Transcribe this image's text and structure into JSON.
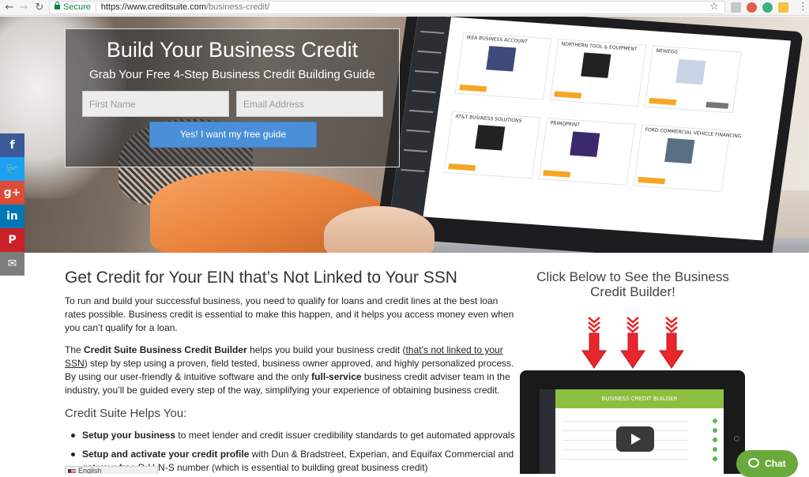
{
  "browser": {
    "secure_label": "Secure",
    "url_main": "https://www.creditsuite.com",
    "url_path": "/business-credit/"
  },
  "hero": {
    "title": "Build Your Business Credit",
    "subtitle": "Grab Your Free 4-Step Business Credit Building Guide",
    "first_name_placeholder": "First Name",
    "email_placeholder": "Email Address",
    "cta_label": "Yes! I want my free guide"
  },
  "laptop_cards": [
    "IKEA BUSINESS ACCOUNT",
    "NORTHERN TOOL & EQUIPMENT",
    "NEWEGG",
    "AT&T BUSINESS SOLUTIONS",
    "PRIMOPRINT",
    "FORD COMMERCIAL VEHICLE FINANCING"
  ],
  "social": [
    {
      "icon": "facebook-icon",
      "glyph": "f",
      "color": "#3b5998"
    },
    {
      "icon": "twitter-icon",
      "glyph": "🐦",
      "color": "#1da1f2"
    },
    {
      "icon": "google-plus-icon",
      "glyph": "g+",
      "color": "#dd4b39"
    },
    {
      "icon": "linkedin-icon",
      "glyph": "in",
      "color": "#0077b5"
    },
    {
      "icon": "pinterest-icon",
      "glyph": "P",
      "color": "#cb2027"
    },
    {
      "icon": "email-icon",
      "glyph": "✉",
      "color": "#7d7d7d"
    }
  ],
  "main": {
    "heading": "Get Credit for Your EIN that’s Not Linked to Your SSN",
    "para1": "To run and build your successful business, you need to qualify for loans and credit lines at the best loan rates possible.  Business credit is essential to make this happen, and it helps you access money even when you can’t qualify for a loan.",
    "para2_a": "The ",
    "para2_bold1": "Credit Suite Business Credit Builder",
    "para2_b": " helps you build your business credit (",
    "para2_link": "that’s not linked to your SSN",
    "para2_c": ") step by step using a proven, field tested, business owner approved, and highly personalized process. By using our user-friendly & intuitive software and the only ",
    "para2_bold2": "full-service",
    "para2_d": " business credit adviser team in the industry, you’ll be guided every step of the way, simplifying your experience of obtaining business credit.",
    "helps_heading": "Credit Suite Helps You:",
    "bullet1_bold": "Setup your business",
    "bullet1_rest": " to meet lender and credit issuer credibility standards to get automated approvals",
    "bullet2_bold": "Setup and activate your credit profile",
    "bullet2_rest": " with Dun & Bradstreet, Experian, and Equifax Commercial and get your free D-U-N-S number (which is essential to building great business credit)"
  },
  "sidebar": {
    "title": "Click Below to See the Business Credit Builder!",
    "video_header": "BUSINESS CREDIT BUILDER"
  },
  "chat": {
    "label": "Chat"
  },
  "language": {
    "label": "English"
  },
  "colors": {
    "cta_blue": "#4a90d9",
    "chat_green": "#6aaa3d",
    "arrow_red": "#e8262b"
  }
}
